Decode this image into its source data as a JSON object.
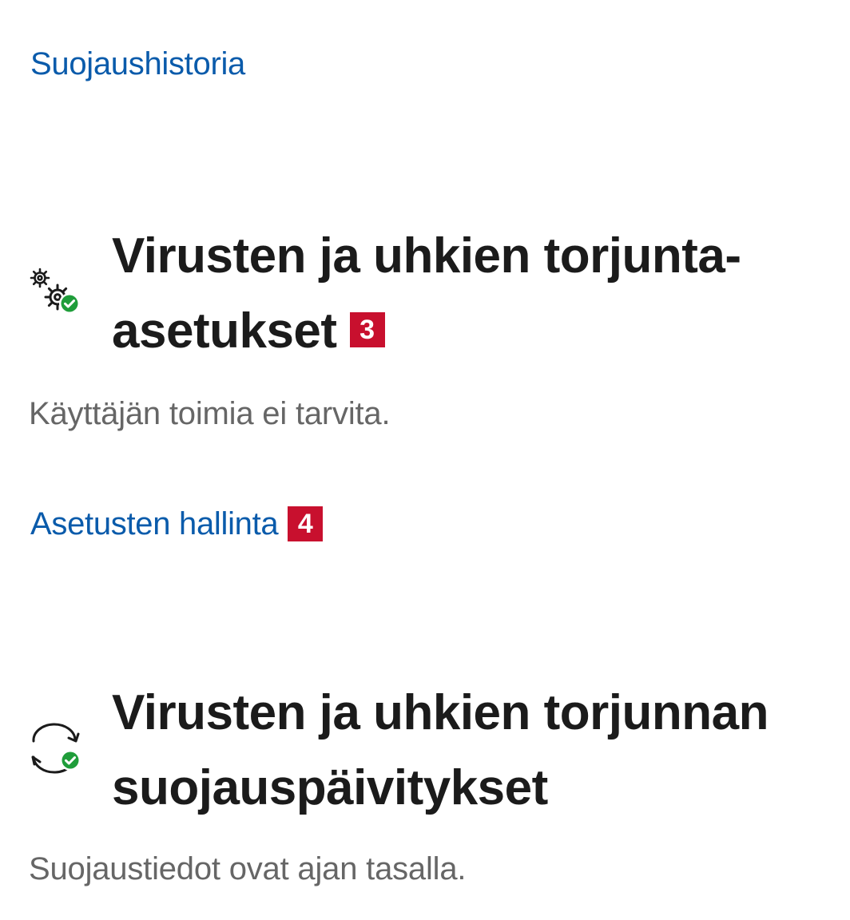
{
  "history_link": {
    "label": "Suojaushistoria"
  },
  "settings_section": {
    "icon": "settings-gears-check-icon",
    "title_line1": "Virusten ja uhkien torjunta-",
    "title_line2": "asetukset",
    "badge": "3",
    "description": "Käyttäjän toimia ei tarvita.",
    "manage_link": "Asetusten hallinta",
    "manage_badge": "4"
  },
  "updates_section": {
    "icon": "sync-check-icon",
    "title_line1": "Virusten ja uhkien torjunnan",
    "title_line2": "suojauspäivitykset",
    "description": "Suojaustiedot ovat ajan tasalla."
  },
  "colors": {
    "link": "#0a5bab",
    "badge": "#c8102e",
    "status_ok": "#1f9d3a"
  }
}
